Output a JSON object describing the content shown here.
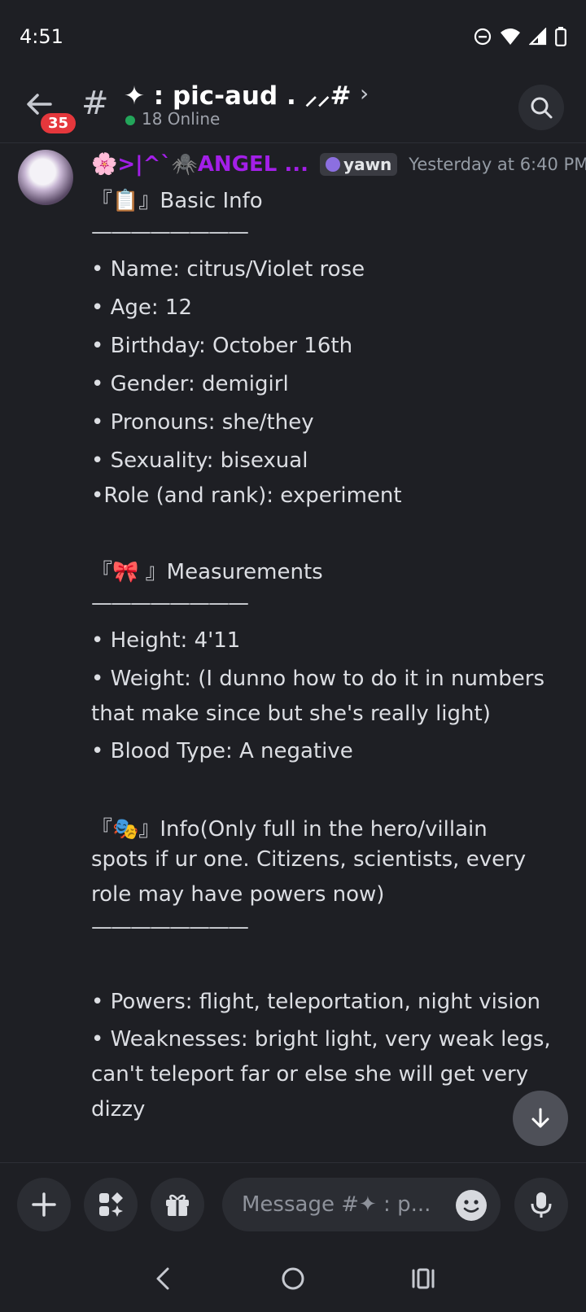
{
  "status_bar": {
    "time": "4:51"
  },
  "header": {
    "unread_badge": "35",
    "channel_name": "✦ : pic-aud . ⸝⸝#",
    "online": "18 Online"
  },
  "message": {
    "username": "🌸>|^`🕷️ANGEL ...",
    "role_tag": "yawn",
    "timestamp": "Yesterday at 6:40 PM",
    "lines": [
      "『📋』Basic Info",
      "————————",
      " • Name: citrus/Violet rose",
      " • Age: 12",
      " • Birthday: October 16th",
      " • Gender: demigirl",
      " • Pronouns: she/they",
      " • Sexuality: bisexual",
      " •Role (and rank): experiment",
      "『🎀 』Measurements",
      "————————",
      " •  Height: 4'11",
      " •  Weight: (I dunno how to do it in numbers",
      "that make since but she's really light)",
      " •  Blood Type: A negative",
      "『🎭』Info(Only full in the hero/villain",
      "spots if ur one. Citizens, scientists, every",
      "role may have powers now)",
      "————————",
      " • Powers: flight, teleportation, night vision",
      " • Weaknesses: bright light, very weak legs,",
      "can't teleport far or else she will get very",
      "dizzy"
    ]
  },
  "composer": {
    "placeholder": "Message #✦ : p..."
  },
  "colors": {
    "background": "#1e1f24",
    "username": "#a31fe8",
    "badge": "#e5373c",
    "online": "#23a55a"
  }
}
